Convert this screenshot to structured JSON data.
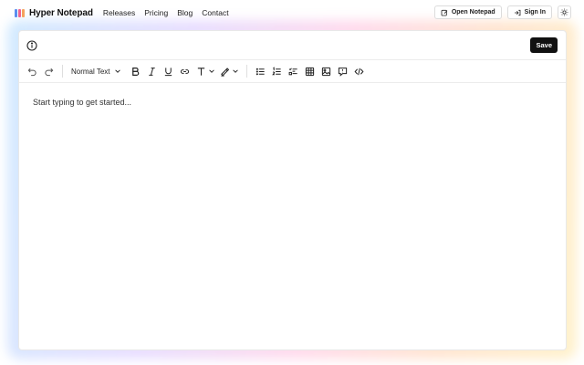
{
  "brand": {
    "name": "Hyper Notepad",
    "logo_colors": [
      "#5b8def",
      "#f06292",
      "#f5a25d"
    ]
  },
  "nav": {
    "links": [
      "Releases",
      "Pricing",
      "Blog",
      "Contact"
    ],
    "open_notepad_label": "Open Notepad",
    "sign_in_label": "Sign In"
  },
  "editor": {
    "save_label": "Save",
    "text_style": "Normal Text",
    "placeholder": "Start typing to get started..."
  },
  "colors": {
    "accent": "#111111",
    "glow": [
      "#cfe9ff",
      "#e7dcff",
      "#ffd9ec",
      "#ffe4cf",
      "#fff1c9"
    ]
  },
  "toolbar_icons": [
    "undo-icon",
    "redo-icon",
    "bold-icon",
    "italic-icon",
    "underline-icon",
    "link-icon",
    "text-color-icon",
    "highlight-icon",
    "bullet-list-icon",
    "numbered-list-icon",
    "checklist-icon",
    "table-icon",
    "image-icon",
    "comment-icon",
    "code-icon"
  ]
}
